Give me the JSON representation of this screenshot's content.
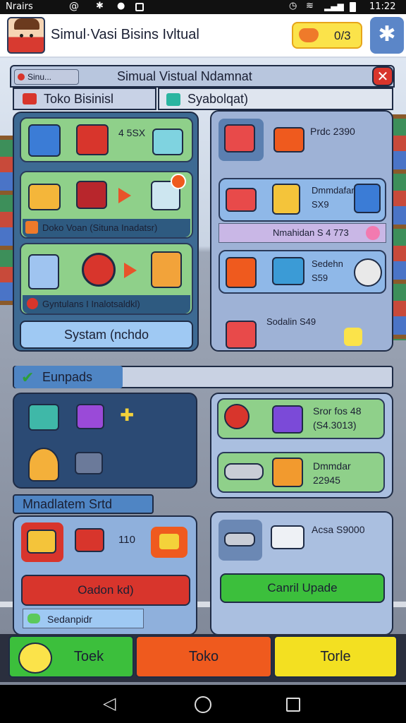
{
  "status_bar": {
    "carrier": "Nrairs",
    "time": "11:22"
  },
  "app_bar": {
    "title": "Simul·Vasi Bisins Ivltual",
    "coins": "0/3"
  },
  "window": {
    "title": "Simual Vistual Ndamnat",
    "mini_tab": "Sinu...",
    "tab_store": "Toko Bisinisl",
    "tab_system": "Syabolqat)"
  },
  "left_panel": {
    "top_value": "4 5SX",
    "machine_label": "Doko Voan (Situna Inadatsr)",
    "system_label": "Gyntulans I Inalotsaldkl)",
    "system_button": "Systam (nchdo"
  },
  "right_panel": {
    "prod_label": "Prdc 2390",
    "row2_title": "Dmmdafar",
    "row2_value": "SX9",
    "bar_label": "Nmahidan S 4 773",
    "row3_title": "Sedehn",
    "row3_value": "S59",
    "row4_label": "Sodalin S49"
  },
  "upgrades": {
    "header": "Eunpads",
    "right_top_title": "Sror fos 48",
    "right_top_value": "(S4.3013)",
    "right_mid_title": "Dmmdar",
    "right_mid_value": "22945"
  },
  "manager": {
    "header": "Mnadlatem Srtd",
    "value": "110",
    "red_button": "Oadon kd)",
    "chip": "Sedanpidr",
    "right_value": "Acsa S9000",
    "green_button": "Canril Upade"
  },
  "bottom_tabs": [
    "Toek",
    "Toko",
    "Torle"
  ],
  "colors": {
    "green": "#3cbf3c",
    "orange": "#ef5a1e",
    "yellow": "#f3e021",
    "accent_red": "#d8352c",
    "panel_blue": "#2b4a74"
  },
  "icons": [
    "avatar",
    "star-icon",
    "gem-icon",
    "close-icon",
    "check-icon",
    "back-icon",
    "home-icon",
    "recents-icon"
  ]
}
